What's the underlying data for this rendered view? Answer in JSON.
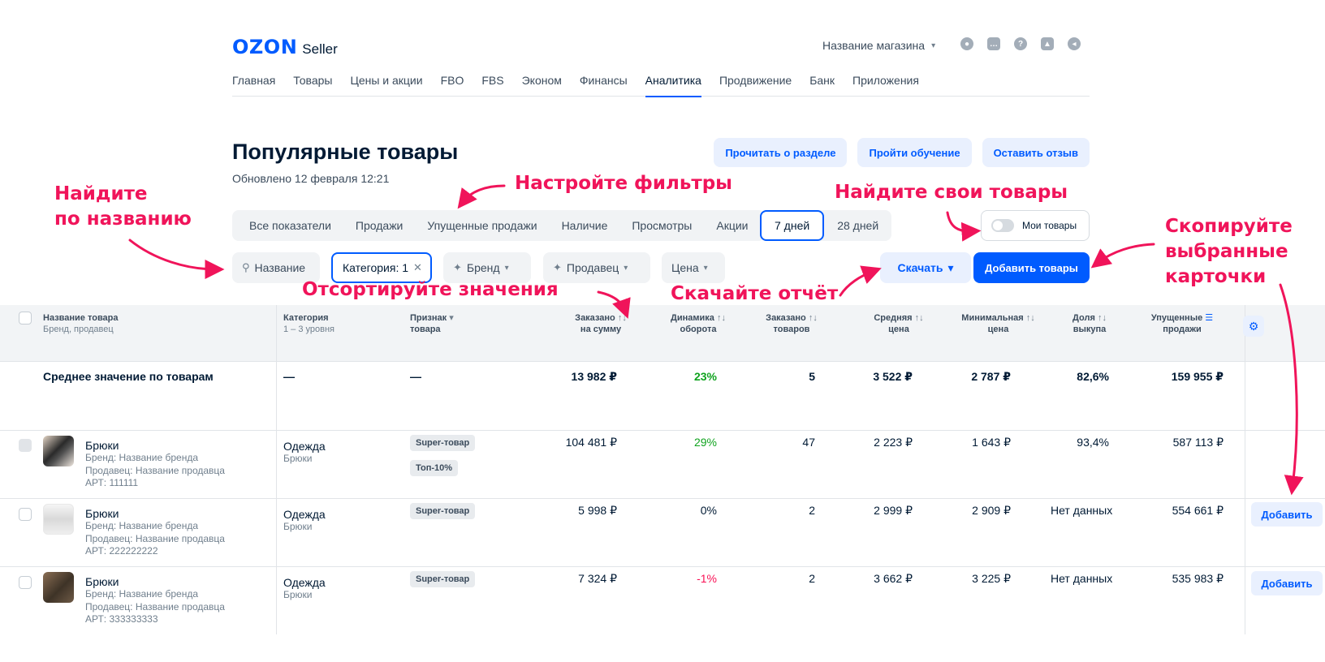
{
  "header": {
    "logo_ozon": "OZON",
    "logo_seller": "Seller",
    "store_name": "Название магазина",
    "icons": [
      "user-icon",
      "chat-icon",
      "help-icon",
      "education-icon",
      "announce-icon"
    ]
  },
  "nav": {
    "items": [
      "Главная",
      "Товары",
      "Цены и акции",
      "FBO",
      "FBS",
      "Эконом",
      "Финансы",
      "Аналитика",
      "Продвижение",
      "Банк",
      "Приложения"
    ],
    "active": "Аналитика"
  },
  "page": {
    "title": "Популярные товары",
    "updated": "Обновлено 12 февраля 12:21",
    "buttons": {
      "read": "Прочитать о разделе",
      "learn": "Пройти обучение",
      "feedback": "Оставить отзыв"
    }
  },
  "tabs": {
    "metrics": [
      "Все показатели",
      "Продажи",
      "Упущенные продажи",
      "Наличие",
      "Просмотры",
      "Акции"
    ],
    "periods": [
      "7 дней",
      "28 дней"
    ],
    "period_active": "7 дней",
    "my_products": "Мои товары"
  },
  "filters": {
    "search_placeholder": "Название",
    "category": "Категория: 1",
    "brand": "Бренд",
    "seller": "Продавец",
    "price": "Цена",
    "download": "Скачать",
    "add_products": "Добавить товары"
  },
  "table": {
    "columns": {
      "name": "Название товара",
      "name_sub": "Бренд, продавец",
      "category": "Категория",
      "category_sub": "1 – 3 уровня",
      "feature": "Признак",
      "feature2": "товара",
      "ordered_sum": "Заказано",
      "ordered_sum2": "на сумму",
      "dynamics": "Динамика",
      "dynamics2": "оборота",
      "ordered_qty": "Заказано",
      "ordered_qty2": "товаров",
      "avg_price": "Средняя",
      "avg_price2": "цена",
      "min_price": "Минимальная",
      "min_price2": "цена",
      "buyout": "Доля",
      "buyout2": "выкупа",
      "lost": "Упущенные",
      "lost2": "продажи"
    },
    "average": {
      "label": "Среднее значение по товарам",
      "category": "—",
      "feature": "—",
      "ordered_sum": "13 982 ₽",
      "dynamics": "23%",
      "ordered_qty": "5",
      "avg_price": "3 522 ₽",
      "min_price": "2 787 ₽",
      "buyout": "82,6%",
      "lost": "159 955 ₽"
    },
    "rows": [
      {
        "name": "Брюки",
        "brand": "Бренд: Название бренда",
        "seller": "Продавец: Название продавца",
        "sku": "АРТ: 111111",
        "category": "Одежда",
        "subcategory": "Брюки",
        "badge1": "Super-товар",
        "badge2": "Топ-10%",
        "ordered_sum": "104 481 ₽",
        "dynamics": "29%",
        "ordered_qty": "47",
        "avg_price": "2 223 ₽",
        "min_price": "1 643 ₽",
        "buyout": "93,4%",
        "lost": "587 113 ₽",
        "action": ""
      },
      {
        "name": "Брюки",
        "brand": "Бренд: Название бренда",
        "seller": "Продавец: Название продавца",
        "sku": "АРТ: 222222222",
        "category": "Одежда",
        "subcategory": "Брюки",
        "badge1": "Super-товар",
        "ordered_sum": "5 998 ₽",
        "dynamics": "0%",
        "ordered_qty": "2",
        "avg_price": "2 999 ₽",
        "min_price": "2 909 ₽",
        "buyout": "Нет данных",
        "lost": "554 661 ₽",
        "action": "Добавить"
      },
      {
        "name": "Брюки",
        "brand": "Бренд: Название бренда",
        "seller": "Продавец: Название продавца",
        "sku": "АРТ: 333333333",
        "category": "Одежда",
        "subcategory": "Брюки",
        "badge1": "Super-товар",
        "ordered_sum": "7 324 ₽",
        "dynamics": "-1%",
        "ordered_qty": "2",
        "avg_price": "3 662 ₽",
        "min_price": "3 225 ₽",
        "buyout": "Нет данных",
        "lost": "535 983 ₽",
        "action": "Добавить"
      }
    ]
  },
  "annotations": {
    "find_by_name_1": "Найдите",
    "find_by_name_2": "по названию",
    "set_filters": "Настройте фильтры",
    "find_own": "Найдите свои товары",
    "copy_1": "Скопируйте",
    "copy_2": "выбранные",
    "copy_3": "карточки",
    "sort": "Отсортируйте значения",
    "download_report": "Скачайте отчёт"
  },
  "colors": {
    "brand": "#005bff",
    "annotation": "#f0145a",
    "positive": "#10a31f",
    "negative": "#f91155"
  }
}
